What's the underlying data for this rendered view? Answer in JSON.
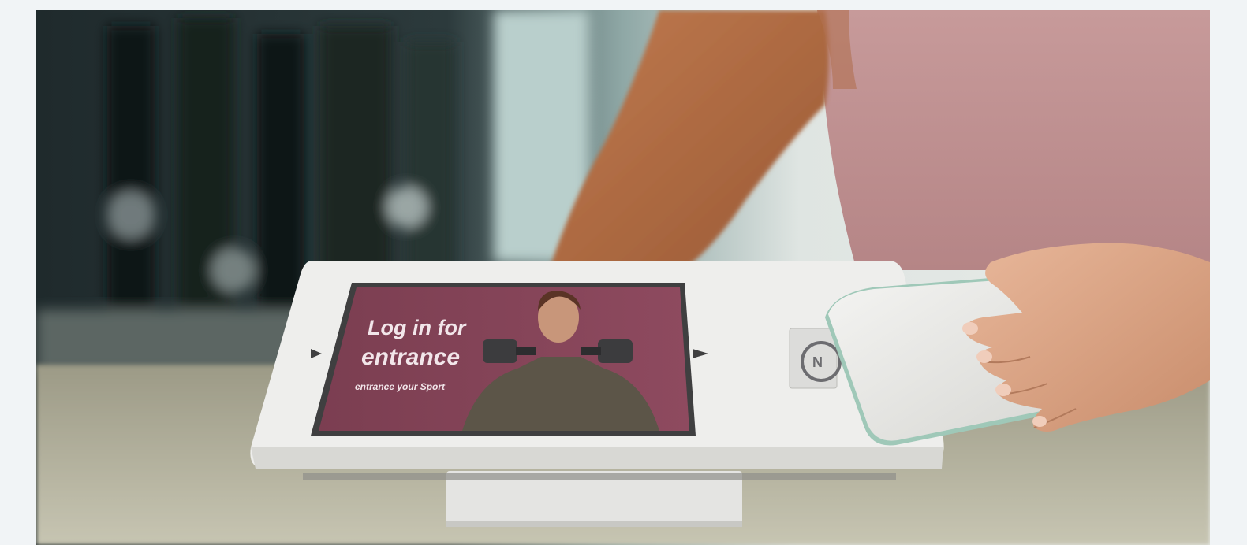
{
  "photo": {
    "kiosk_screen": {
      "headline_line1": "Log in for",
      "headline_line2": "entrance",
      "subline": "entrance your Sport"
    },
    "nfc_label": "N"
  },
  "colors": {
    "page_background": "#f1f4f6",
    "screen_tint": "#8a4a5c",
    "kiosk_body": "#ececea",
    "shirt": "#c99a9c"
  }
}
